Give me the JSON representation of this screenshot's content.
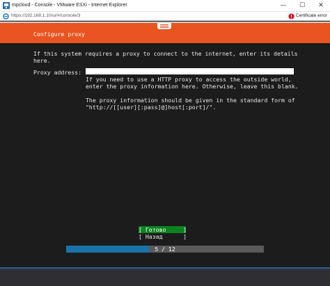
{
  "window": {
    "title": "mpcloud - Console - VMware ESXi - Internet Explorer",
    "minimize_glyph": "—",
    "maximize_glyph": "☐",
    "close_glyph": "✕"
  },
  "address_bar": {
    "url": "https://192.168.1.10/ui/#/console/3",
    "certificate_label": "Certificate error"
  },
  "installer": {
    "title": "Configure proxy",
    "intro": "If this system requires a proxy to connect to the internet, enter its details\nhere.",
    "proxy_label": "Proxy address:",
    "proxy_value": "",
    "help": "If you need to use a HTTP proxy to access the outside world,\nenter the proxy information here. Otherwise, leave this blank.\n\nThe proxy information should be given in the standard form of\n\"http://[[user][:pass]@]host[:port]/\".",
    "done_button": "[ Готово     ]",
    "back_button": "[ Назад      ]",
    "progress_text": "5 / 12",
    "progress_fraction": 0.42
  },
  "colors": {
    "header": "#e95420",
    "done_button": "#0e8420",
    "progress_fill": "#1a73a8",
    "console_bg": "#1c1c1c"
  },
  "icons": [
    "app-icon",
    "ie-icon",
    "cert-warning-icon",
    "menu-icon"
  ]
}
